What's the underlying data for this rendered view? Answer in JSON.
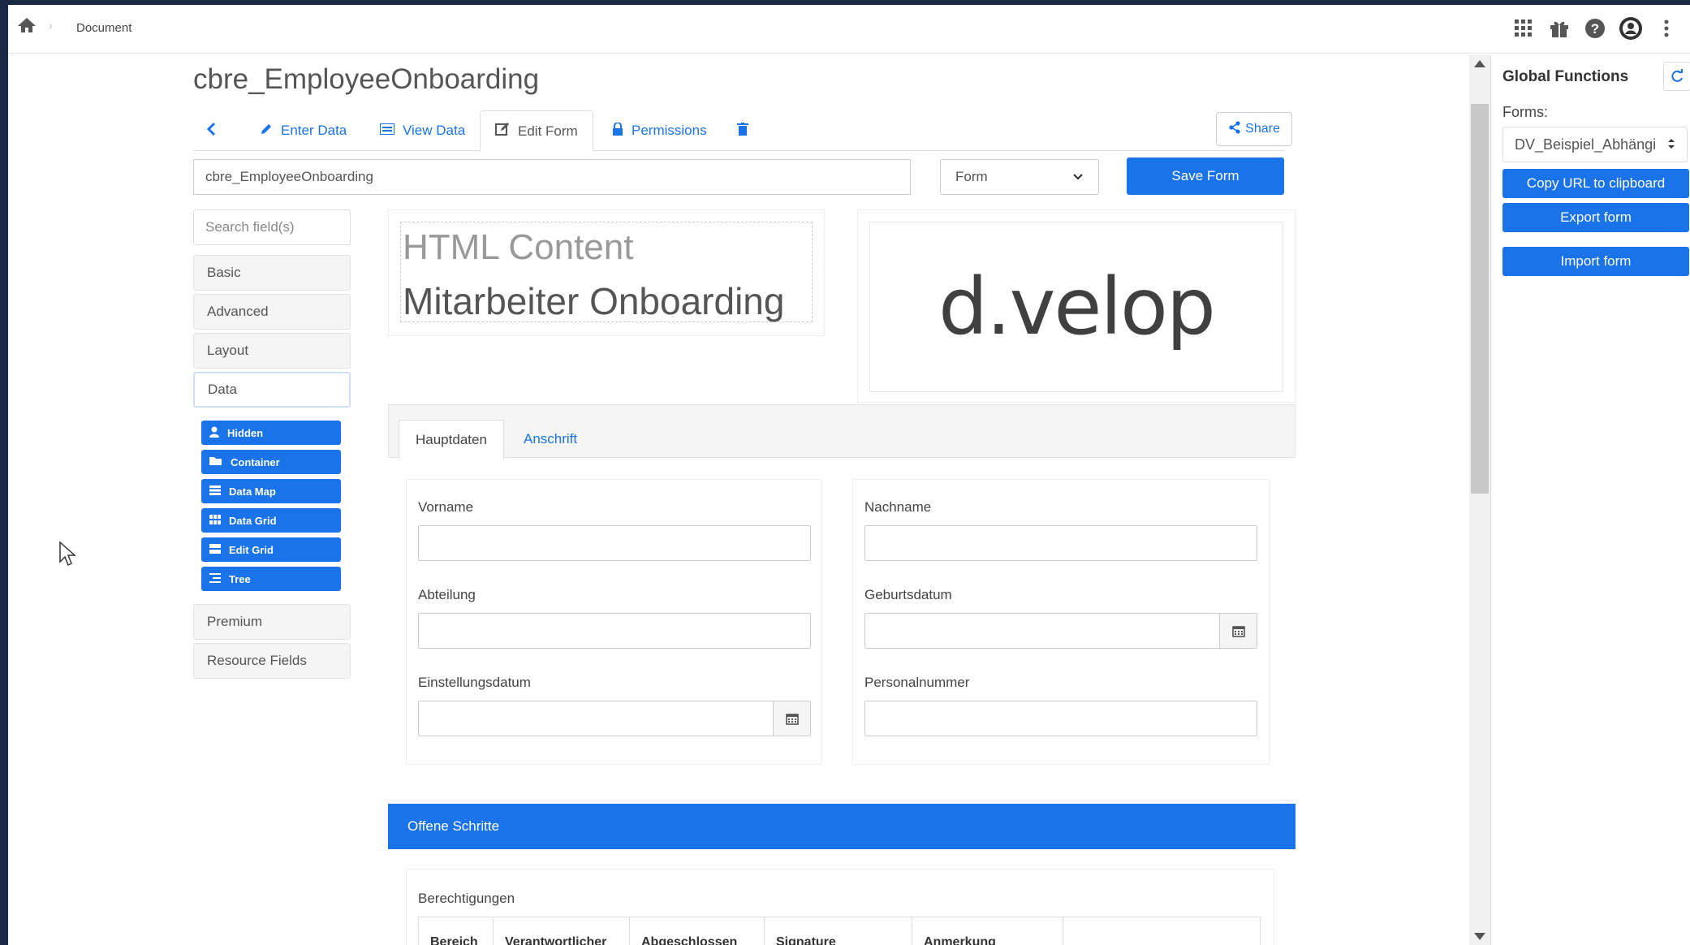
{
  "topbar": {
    "breadcrumb": "Document",
    "icons": [
      "home-icon",
      "apps-grid-icon",
      "gift-icon",
      "help-icon",
      "user-avatar-icon",
      "more-vertical-icon"
    ]
  },
  "page": {
    "title": "cbre_EmployeeOnboarding",
    "tabs": {
      "back_icon": "chevron-left-icon",
      "enter_data": "Enter Data",
      "view_data": "View Data",
      "edit_form": "Edit Form",
      "permissions": "Permissions",
      "delete_icon": "trash-icon"
    },
    "share_label": "Share",
    "form_name_value": "cbre_EmployeeOnboarding",
    "form_type_value": "Form",
    "save_label": "Save Form"
  },
  "builder": {
    "search_placeholder": "Search field(s)",
    "groups": {
      "basic": "Basic",
      "advanced": "Advanced",
      "layout": "Layout",
      "data": "Data",
      "premium": "Premium",
      "resource": "Resource Fields"
    },
    "components": [
      "Hidden",
      "Container",
      "Data Map",
      "Data Grid",
      "Edit Grid",
      "Tree"
    ]
  },
  "canvas": {
    "html_heading": "HTML Content",
    "html_text": "Mitarbeiter Onboarding",
    "logo_text": "d.velop",
    "form_tabs": [
      "Hauptdaten",
      "Anschrift"
    ],
    "fields": {
      "vorname": "Vorname",
      "nachname": "Nachname",
      "abteilung": "Abteilung",
      "geburtsdatum": "Geburtsdatum",
      "einstellungsdatum": "Einstellungsdatum",
      "personalnummer": "Personalnummer"
    },
    "panel_title": "Offene Schritte",
    "grid_label": "Berechtigungen",
    "grid_columns": [
      "Bereich",
      "Verantwortlicher",
      "Abgeschlossen",
      "Signature",
      "Anmerkung"
    ]
  },
  "right_panel": {
    "title": "Global Functions",
    "forms_label": "Forms:",
    "forms_value": "DV_Beispiel_Abhängi",
    "copy_url": "Copy URL to clipboard",
    "export": "Export form",
    "import": "Import form"
  },
  "colors": {
    "accent": "#1a73e8",
    "background": "#1b2a44"
  }
}
